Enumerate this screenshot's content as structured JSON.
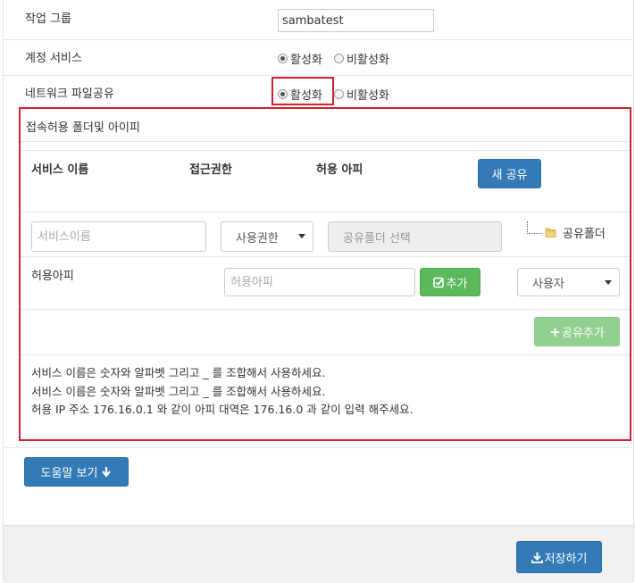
{
  "form": {
    "workgroup_label": "작업 그룹",
    "workgroup_value": "sambatest",
    "account_service_label": "계정 서비스",
    "account_service_options": [
      "활성화",
      "비활성화"
    ],
    "network_share_label": "네트워크 파일공유",
    "network_share_options": [
      "활성화",
      "비활성화"
    ]
  },
  "share_panel": {
    "title": "접속허용 폴더및 아이피",
    "headers": {
      "service_name": "서비스 이름",
      "access": "접근권한",
      "allowed_ip": "허용 아피"
    },
    "new_share_button": "새 공유",
    "service_name_placeholder": "서비스이름",
    "permission_select": "사용권한",
    "folder_select_placeholder": "공유폴더 선택",
    "tree_folder_label": "공유폴더",
    "allowed_ip_label": "허용아피",
    "allowed_ip_placeholder": "허용아피",
    "add_button": "추가",
    "user_select": "사용자",
    "add_share_button": "공유추가",
    "notes": [
      "서비스 이름은 숫자와 알파벳 그리고 _ 를 조합해서 사용하세요.",
      "서비스 이름은 숫자와 알파벳 그리고 _ 를 조합해서 사용하세요.",
      "허용 IP 주소 176.16.0.1 와 같이 아피 대역은 176.16.0 과 같이 입력 해주세요."
    ]
  },
  "help_button": "도움말 보기",
  "save_button": "저장하기",
  "colors": {
    "primary": "#337ab7",
    "success": "#5cb85c",
    "highlight": "#d2202f"
  }
}
